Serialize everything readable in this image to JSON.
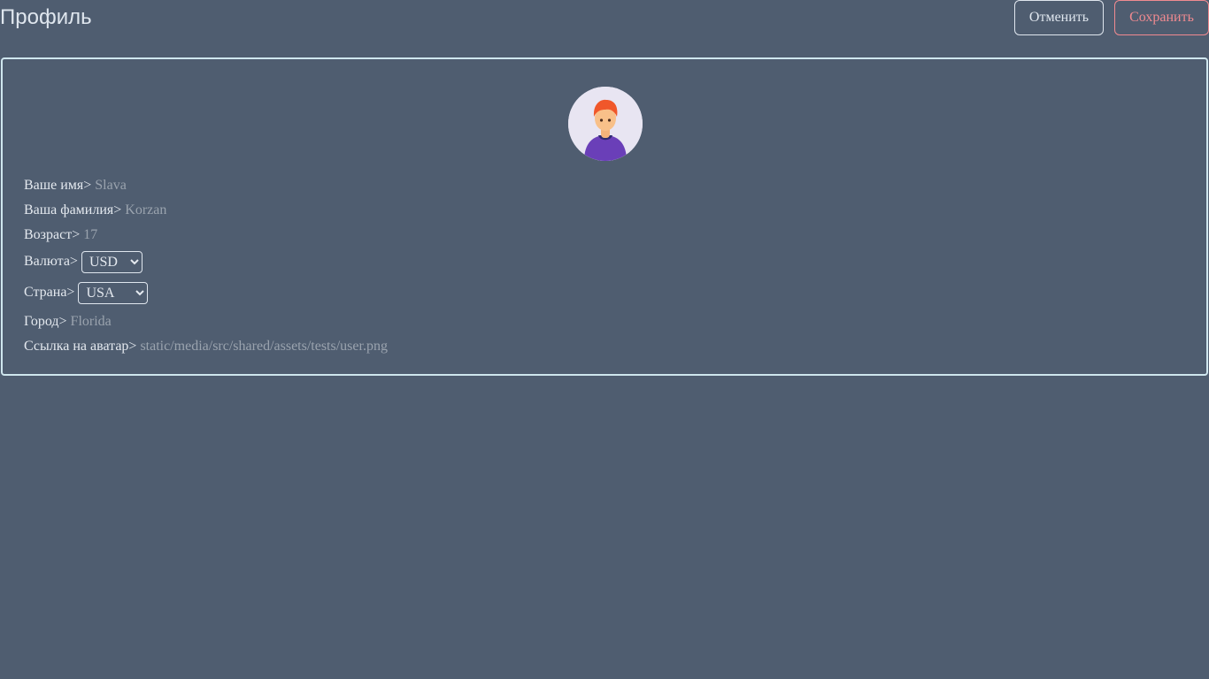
{
  "header": {
    "title": "Профиль",
    "cancel_label": "Отменить",
    "save_label": "Сохранить"
  },
  "profile": {
    "first_name": {
      "label": "Ваше имя>",
      "value": "Slava"
    },
    "last_name": {
      "label": "Ваша фамилия>",
      "value": "Korzan"
    },
    "age": {
      "label": "Возраст>",
      "value": "17"
    },
    "currency": {
      "label": "Валюта>",
      "value": "USD"
    },
    "country": {
      "label": "Страна>",
      "value": "USA"
    },
    "city": {
      "label": "Город>",
      "value": "Florida"
    },
    "avatar": {
      "label": "Ссылка на аватар>",
      "value": "static/media/src/shared/assets/tests/user.png"
    }
  },
  "colors": {
    "background": "#4f5d70",
    "text": "#e4e9ef",
    "muted_value": "#9aa3ae",
    "card_border": "#cfe6ee",
    "save_accent": "#f08a90"
  },
  "icons": {
    "avatar": "user-avatar-icon"
  }
}
